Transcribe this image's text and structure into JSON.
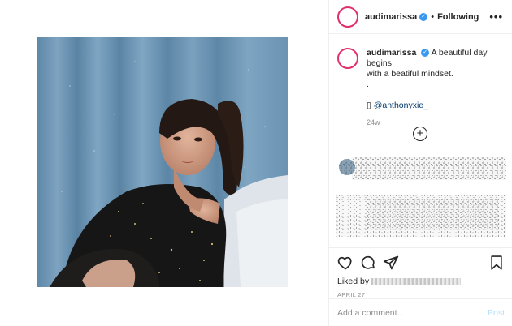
{
  "header": {
    "username": "audimarissa",
    "verified_icon": "verified-badge-icon",
    "separator": "•",
    "follow_status": "Following",
    "more_icon": "more-options-icon",
    "more_glyph": "•••"
  },
  "caption": {
    "username": "audimarissa",
    "text_line1": "A beautiful day begins",
    "text_line2": "with a beatiful mindset.",
    "dot1": ".",
    "dot2": ".",
    "mention_prefix": "▯",
    "mention": "@anthonyxie_",
    "time": "24w"
  },
  "load_more": {
    "glyph": "+"
  },
  "actions": {
    "like_icon": "heart-icon",
    "comment_icon": "comment-icon",
    "share_icon": "share-icon",
    "save_icon": "bookmark-icon",
    "liked_by_prefix": "Liked by",
    "date": "APRIL 27"
  },
  "comment_box": {
    "placeholder": "Add a comment...",
    "post_label": "Post"
  },
  "colors": {
    "accent_blue": "#3897f0",
    "story_ring": "#e1306c",
    "post_disabled": "#b2dffc",
    "curtain_blue": "#6a93b3"
  }
}
